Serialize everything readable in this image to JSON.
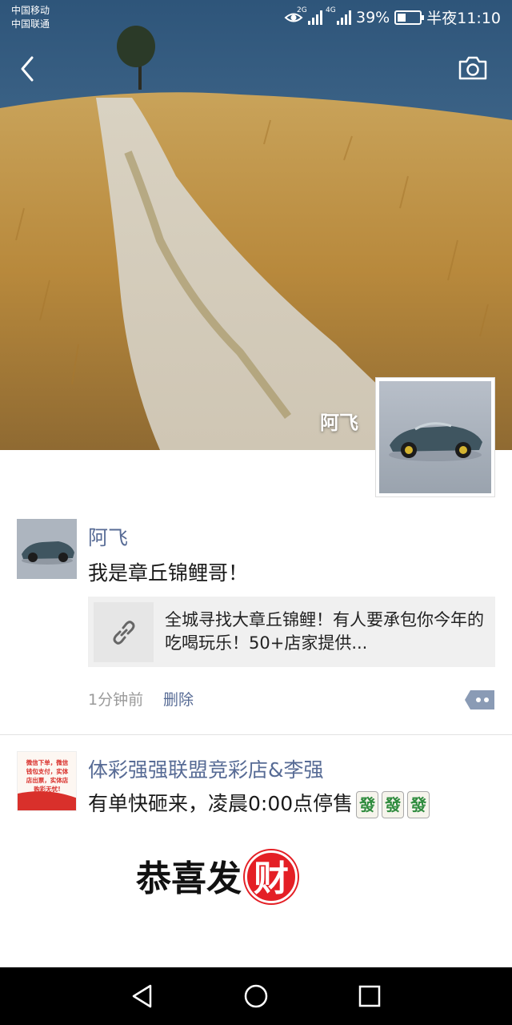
{
  "status_bar": {
    "carrier1": "中国移动",
    "carrier2": "中国联通",
    "net1": "2G",
    "net2": "4G",
    "battery": "39%",
    "battery_level": 0.39,
    "time": "半夜11:10"
  },
  "header": {
    "back_icon": "chevron-left-icon",
    "camera_icon": "camera-icon",
    "cover_name": "阿飞"
  },
  "posts": [
    {
      "author": "阿飞",
      "text": "我是章丘锦鲤哥！",
      "link_title": "全城寻找大章丘锦鲤！有人要承包你今年的吃喝玩乐！50+店家提供...",
      "time": "1分钟前",
      "delete": "删除"
    },
    {
      "author": "体彩强强联盟竞彩店&李强",
      "text": "有单快砸来，凌晨0:00点停售",
      "emoji": [
        "發",
        "發",
        "發"
      ],
      "avatar_text": "微信下单，微信钱包支付，实体店出票，实体店购彩无忧!",
      "image_text": "恭喜发",
      "image_badge": "财"
    }
  ],
  "colors": {
    "link_blue": "#576b95",
    "sky": "#3c6487",
    "grass": "#c59a4b"
  }
}
